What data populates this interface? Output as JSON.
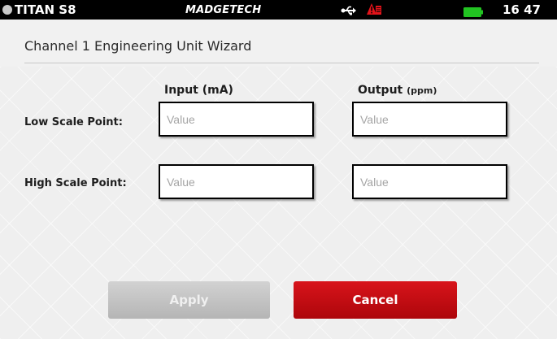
{
  "status_bar": {
    "device_name": "TITAN S8",
    "brand": "MADGETECH",
    "clock": "16 47",
    "icons": [
      "status-dot-icon",
      "usb-icon",
      "alarm-icon",
      "battery-icon"
    ],
    "battery_color": "#22c322",
    "alert_color": "#e3131a"
  },
  "page": {
    "title": "Channel 1 Engineering Unit Wizard"
  },
  "columns": {
    "input": {
      "label": "Input",
      "unit": "(mA)"
    },
    "output": {
      "label": "Output",
      "unit": "(ppm)"
    }
  },
  "rows": {
    "low": {
      "label": "Low Scale Point:",
      "input": {
        "value": "",
        "placeholder": "Value"
      },
      "output": {
        "value": "",
        "placeholder": "Value"
      }
    },
    "high": {
      "label": "High Scale Point:",
      "input": {
        "value": "",
        "placeholder": "Value"
      },
      "output": {
        "value": "",
        "placeholder": "Value"
      }
    }
  },
  "buttons": {
    "apply": {
      "label": "Apply",
      "enabled": false
    },
    "cancel": {
      "label": "Cancel",
      "enabled": true
    }
  },
  "colors": {
    "cancel": "#c80a10",
    "apply_disabled": "#c4c4c4",
    "status_bar": "#000000"
  }
}
